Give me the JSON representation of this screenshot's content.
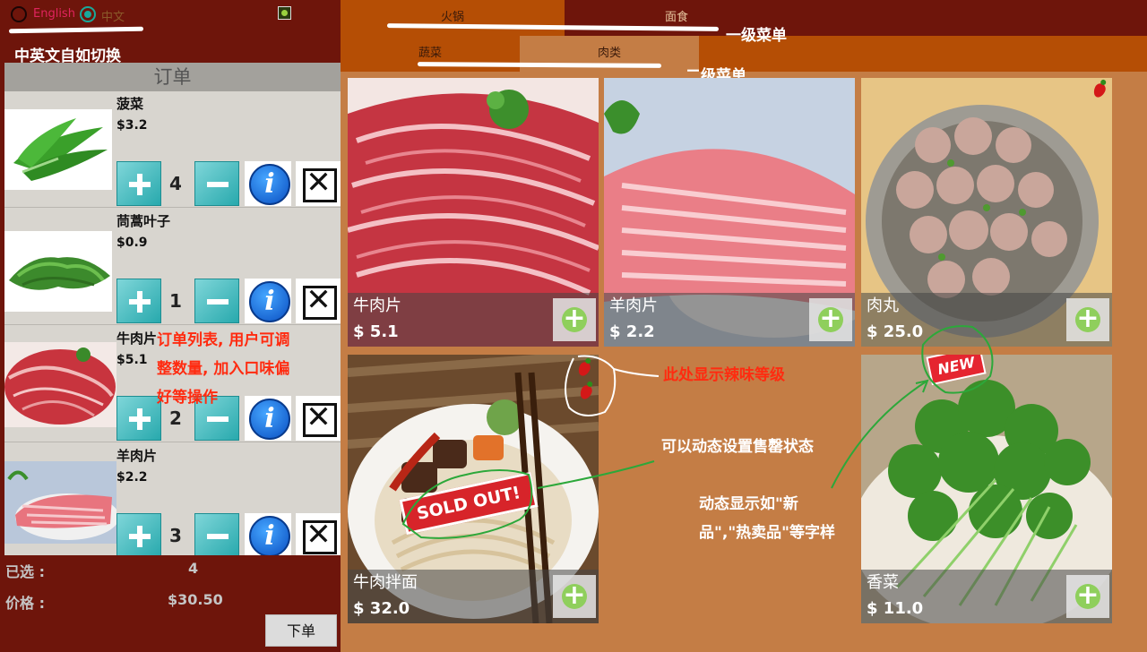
{
  "language": {
    "options": [
      {
        "label": "English",
        "selected": false,
        "color": "#e0245e"
      },
      {
        "label": "中文",
        "selected": true,
        "color": "#8a5a2a"
      }
    ]
  },
  "annotations": {
    "language_switch": "中英文自如切换",
    "level1_menu": "一级菜单",
    "level2_menu": "二级菜单",
    "order_list_note_line1": "订单列表, 用户可调",
    "order_list_note_line2": "整数量, 加入口味偏",
    "order_list_note_line3": "好等操作",
    "spice_level_note": "此处显示辣味等级",
    "sold_out_note": "可以动态设置售罄状态",
    "new_tag_note_line1": "动态显示如\"新",
    "new_tag_note_line2": "品\",\"热卖品\"等字样"
  },
  "order": {
    "title": "订单",
    "items": [
      {
        "name": "菠菜",
        "price": "$3.2",
        "qty": "4",
        "image": "spinach-icon"
      },
      {
        "name": "茼蒿叶子",
        "price": "$0.9",
        "qty": "1",
        "image": "garland-chrysanthemum-icon"
      },
      {
        "name": "牛肉片",
        "price": "$5.1",
        "qty": "2",
        "image": "beef-slices-icon"
      },
      {
        "name": "羊肉片",
        "price": "$2.2",
        "qty": "3",
        "image": "lamb-slices-icon"
      }
    ],
    "selected_label": "已选 :",
    "selected_count": "4",
    "price_label": "价格 :",
    "total": "$30.50",
    "submit": "下单"
  },
  "menu": {
    "level1": [
      {
        "label": "火锅",
        "active": true
      },
      {
        "label": "面食",
        "active": false
      }
    ],
    "level2": [
      {
        "label": "蔬菜",
        "active": false
      },
      {
        "label": "肉类",
        "active": true
      }
    ]
  },
  "dishes": [
    {
      "name": "牛肉片",
      "price": "$ 5.1",
      "image": "raw-beef-slices"
    },
    {
      "name": "羊肉片",
      "price": "$ 2.2",
      "image": "lamb-rolls"
    },
    {
      "name": "肉丸",
      "price": "$ 25.0",
      "image": "meatballs",
      "spicy_level": 1
    },
    {
      "name": "牛肉拌面",
      "price": "$ 32.0",
      "image": "beef-noodles",
      "sold_out": true,
      "sold_out_text": "SOLD OUT!",
      "spicy_level": 2
    },
    {
      "name": "香菜",
      "price": "$ 11.0",
      "image": "coriander",
      "badge": "NEW"
    }
  ],
  "colors": {
    "left_panel": "#6e150b",
    "content_bg": "#c47d45",
    "tab_active_level1": "#b54e05",
    "tab_inactive": "#6e150b",
    "tab_active_level2": "#c47d45",
    "accent_teal": "#28a9ad",
    "annotation_red": "#ff2b10",
    "annotation_green": "#2ca83a"
  }
}
